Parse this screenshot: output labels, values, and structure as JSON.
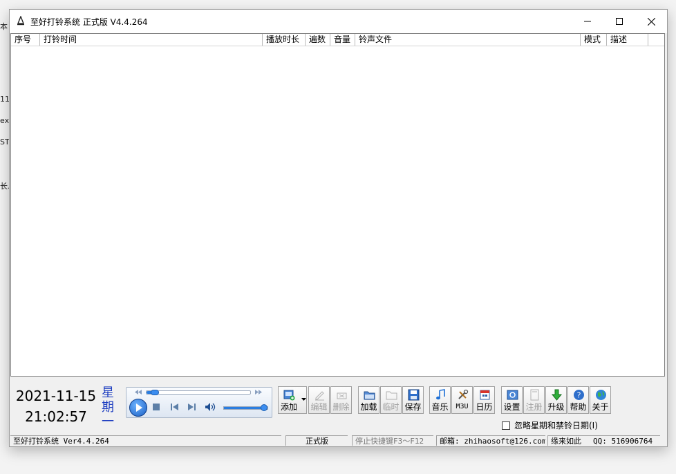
{
  "window": {
    "title": "至好打铃系统 正式版 V4.4.264",
    "controls": {
      "minimize": "minimize",
      "maximize": "maximize",
      "close": "close"
    }
  },
  "background_text": [
    "本",
    "11",
    "ex",
    "ST.",
    "长.c"
  ],
  "table": {
    "columns": [
      "序号",
      "打铃时间",
      "播放时长",
      "遍数",
      "音量",
      "铃声文件",
      "模式",
      "描述"
    ],
    "rows": []
  },
  "clock": {
    "date": "2021-11-15",
    "time": "21:02:57",
    "weekday_line1": "星",
    "weekday_line2": "期",
    "weekday_line3": "一"
  },
  "player": {
    "progress": 0.04,
    "volume": 1.0
  },
  "toolbar": {
    "add": "添加",
    "edit": "编辑",
    "delete": "删除",
    "load": "加载",
    "temp": "临时",
    "save": "保存",
    "music": "音乐",
    "m3u": "M3U",
    "calendar": "日历",
    "settings": "设置",
    "register": "注册",
    "upgrade": "升级",
    "help": "帮助",
    "about": "关于"
  },
  "ignore_checkbox": {
    "label": "忽略星期和禁铃日期(I)",
    "checked": false
  },
  "statusbar": {
    "app": "至好打铃系统 Ver4.4.264",
    "edition": "正式版",
    "hotkey": "停止快捷键F3～F12",
    "email": "邮箱: zhihaosoft@126.com",
    "slogan": "缘来如此",
    "qq": "QQ: 516906764"
  },
  "colors": {
    "weekday": "#1f3fc1",
    "accent": "#1e6fd0"
  }
}
